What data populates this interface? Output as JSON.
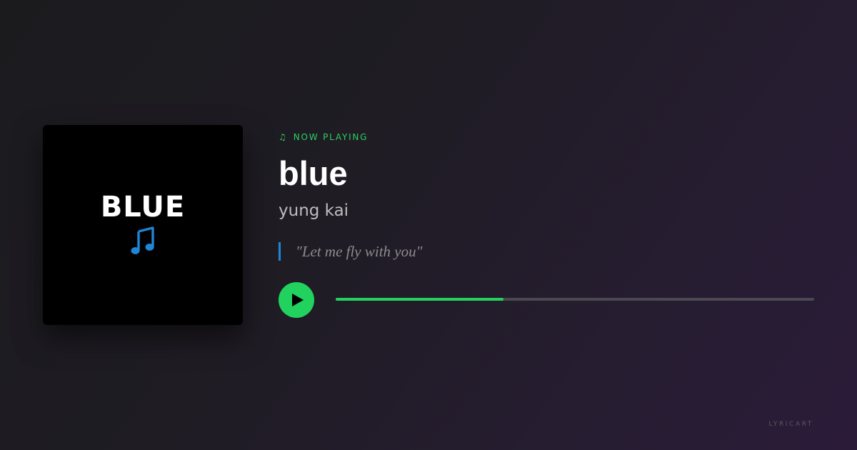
{
  "album": {
    "art_title": "BLUE",
    "art_icon": "music-note-icon",
    "art_icon_color": "#1e86d6"
  },
  "status": {
    "icon": "music-note-icon",
    "label": "NOW PLAYING"
  },
  "track": {
    "title": "blue",
    "artist": "yung kai",
    "lyric": "\"Let me fly with you\""
  },
  "player": {
    "play_icon": "play-icon",
    "progress_fraction": 0.35
  },
  "brand": {
    "name": "LYRICART"
  },
  "colors": {
    "accent": "#22d25e",
    "quote_bar": "#1e86d6",
    "track": "#4a4850"
  }
}
